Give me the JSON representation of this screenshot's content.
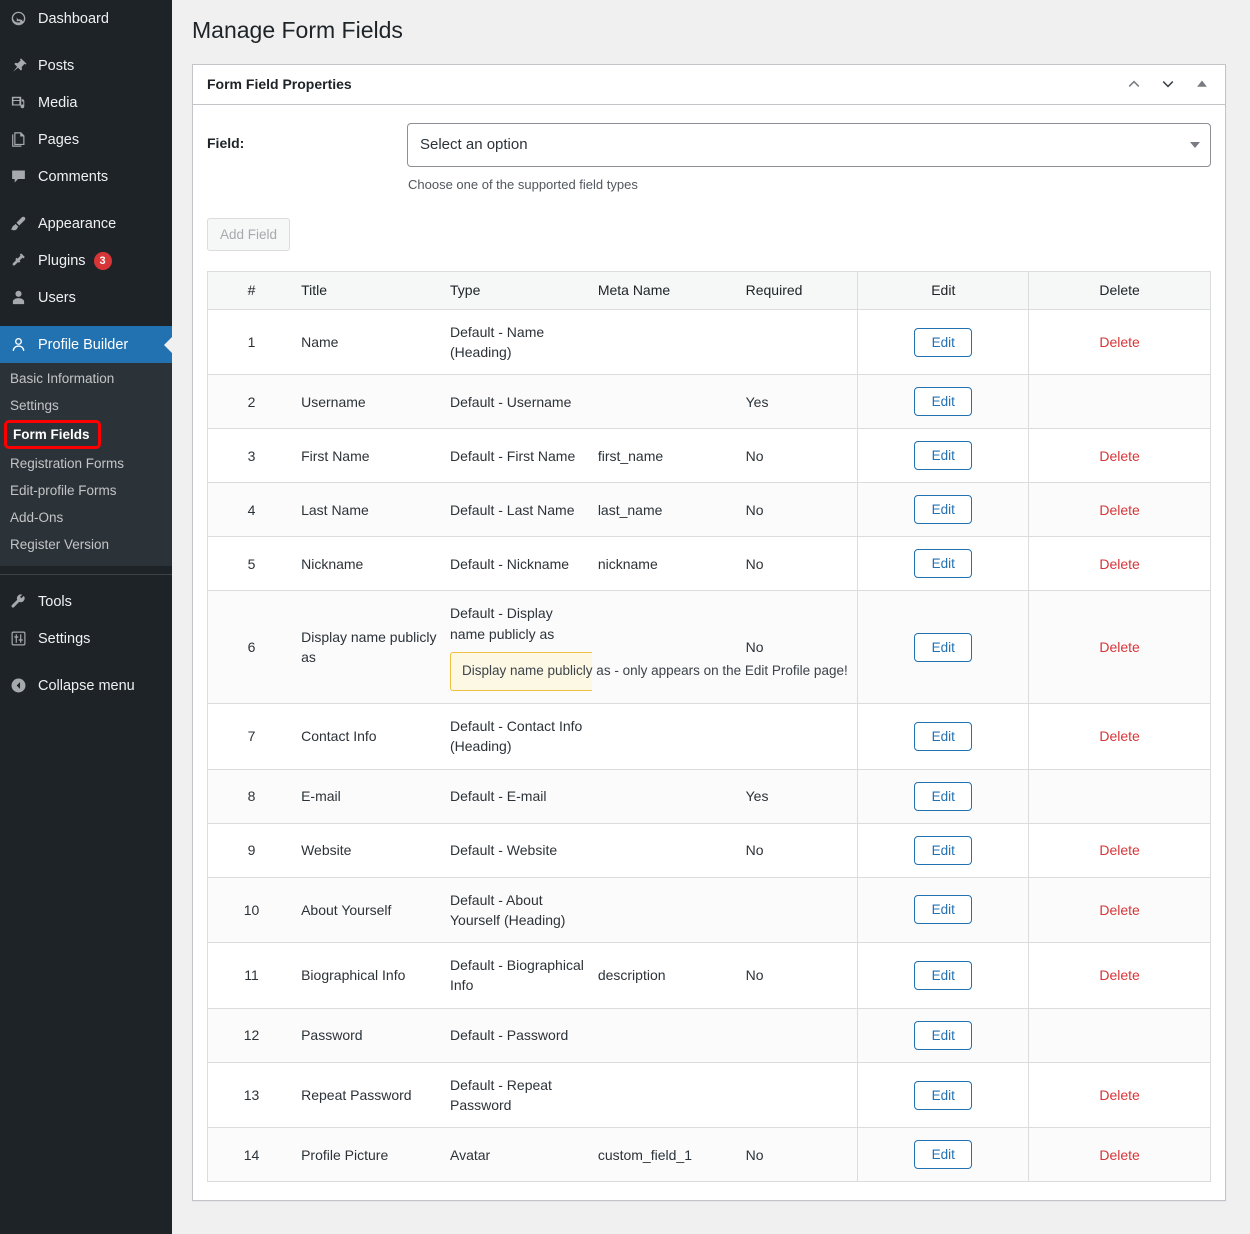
{
  "sidebar": {
    "items": [
      {
        "label": "Dashboard",
        "icon": "dashboard-icon",
        "name": "dashboard"
      },
      {
        "label": "Posts",
        "icon": "pin-icon",
        "name": "posts"
      },
      {
        "label": "Media",
        "icon": "media-icon",
        "name": "media"
      },
      {
        "label": "Pages",
        "icon": "pages-icon",
        "name": "pages"
      },
      {
        "label": "Comments",
        "icon": "comment-icon",
        "name": "comments"
      },
      {
        "label": "Appearance",
        "icon": "brush-icon",
        "name": "appearance"
      },
      {
        "label": "Plugins",
        "icon": "plug-icon",
        "name": "plugins",
        "badge": "3"
      },
      {
        "label": "Users",
        "icon": "user-icon",
        "name": "users"
      },
      {
        "label": "Profile Builder",
        "icon": "profile-builder-icon",
        "name": "profile-builder",
        "active": true
      },
      {
        "label": "Tools",
        "icon": "wrench-icon",
        "name": "tools"
      },
      {
        "label": "Settings",
        "icon": "settings-sliders-icon",
        "name": "settings"
      },
      {
        "label": "Collapse menu",
        "icon": "collapse-arrow-icon",
        "name": "collapse-menu"
      }
    ],
    "submenu": [
      {
        "label": "Basic Information",
        "name": "basic-information"
      },
      {
        "label": "Settings",
        "name": "settings"
      },
      {
        "label": "Form Fields",
        "name": "form-fields",
        "current": true,
        "highlighted": true
      },
      {
        "label": "Registration Forms",
        "name": "registration-forms"
      },
      {
        "label": "Edit-profile Forms",
        "name": "edit-profile-forms"
      },
      {
        "label": "Add-Ons",
        "name": "add-ons"
      },
      {
        "label": "Register Version",
        "name": "register-version"
      }
    ]
  },
  "page": {
    "title": "Manage Form Fields"
  },
  "panel": {
    "title": "Form Field Properties",
    "actions": {
      "move_up": "⌃",
      "move_down": "⌄",
      "toggle": "▲"
    }
  },
  "form": {
    "field_label": "Field:",
    "select_value": "Select an option",
    "help_text": "Choose one of the supported field types",
    "add_button": "Add Field"
  },
  "table": {
    "headers": [
      "#",
      "Title",
      "Type",
      "Meta Name",
      "Required",
      "Edit",
      "Delete"
    ],
    "edit_label": "Edit",
    "delete_label": "Delete",
    "rows": [
      {
        "num": "1",
        "title": "Name",
        "type": "Default - Name (Heading)",
        "meta": "",
        "required": "",
        "edit": true,
        "delete": true
      },
      {
        "num": "2",
        "title": "Username",
        "type": "Default - Username",
        "meta": "",
        "required": "Yes",
        "edit": true,
        "delete": false
      },
      {
        "num": "3",
        "title": "First Name",
        "type": "Default - First Name",
        "meta": "first_name",
        "required": "No",
        "edit": true,
        "delete": true
      },
      {
        "num": "4",
        "title": "Last Name",
        "type": "Default - Last Name",
        "meta": "last_name",
        "required": "No",
        "edit": true,
        "delete": true
      },
      {
        "num": "5",
        "title": "Nickname",
        "type": "Default - Nickname",
        "meta": "nickname",
        "required": "No",
        "edit": true,
        "delete": true
      },
      {
        "num": "6",
        "title": "Display name publicly as",
        "type": "Default - Display name publicly as",
        "meta": "",
        "required": "No",
        "edit": true,
        "delete": true,
        "note": "Display name publicly as - only appears on the Edit Profile page!"
      },
      {
        "num": "7",
        "title": "Contact Info",
        "type": "Default - Contact Info (Heading)",
        "meta": "",
        "required": "",
        "edit": true,
        "delete": true
      },
      {
        "num": "8",
        "title": "E-mail",
        "type": "Default - E-mail",
        "meta": "",
        "required": "Yes",
        "edit": true,
        "delete": false
      },
      {
        "num": "9",
        "title": "Website",
        "type": "Default - Website",
        "meta": "",
        "required": "No",
        "edit": true,
        "delete": true
      },
      {
        "num": "10",
        "title": "About Yourself",
        "type": "Default - About Yourself (Heading)",
        "meta": "",
        "required": "",
        "edit": true,
        "delete": true
      },
      {
        "num": "11",
        "title": "Biographical Info",
        "type": "Default - Biographical Info",
        "meta": "description",
        "required": "No",
        "edit": true,
        "delete": true
      },
      {
        "num": "12",
        "title": "Password",
        "type": "Default - Password",
        "meta": "",
        "required": "",
        "edit": true,
        "delete": false
      },
      {
        "num": "13",
        "title": "Repeat Password",
        "type": "Default - Repeat Password",
        "meta": "",
        "required": "",
        "edit": true,
        "delete": true
      },
      {
        "num": "14",
        "title": "Profile Picture",
        "type": "Avatar",
        "meta": "custom_field_1",
        "required": "No",
        "edit": true,
        "delete": true
      }
    ]
  },
  "colors": {
    "accent": "#2271b1",
    "danger": "#d63638",
    "highlight": "#ff0000",
    "notice_bg": "#fdf8e3",
    "notice_border": "#f0c040"
  }
}
